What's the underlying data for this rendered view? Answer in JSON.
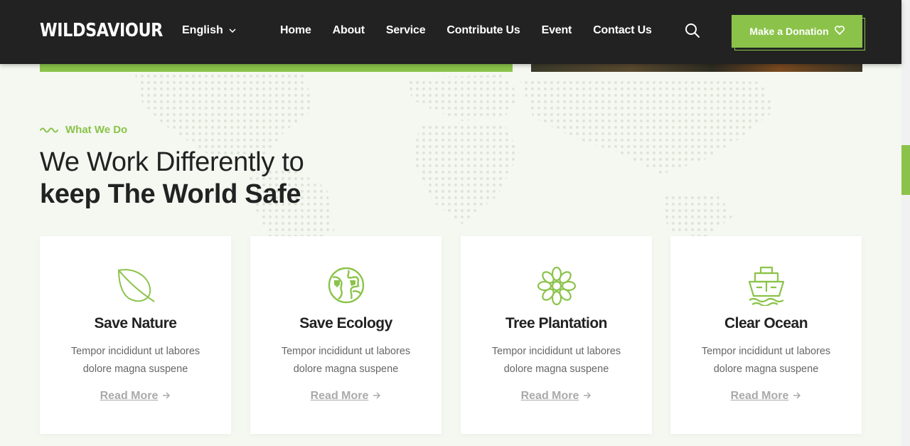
{
  "header": {
    "logo": "WILDSAVIOUR",
    "language": "English",
    "nav": [
      "Home",
      "About",
      "Service",
      "Contribute Us",
      "Event",
      "Contact Us"
    ],
    "donate_label": "Make a Donation"
  },
  "section": {
    "eyebrow": "What We Do",
    "heading_line1": "We Work Differently to",
    "heading_line2": "keep The World Safe"
  },
  "cards": [
    {
      "icon": "leaf-icon",
      "title": "Save Nature",
      "desc_line1": "Tempor incididunt ut labores",
      "desc_line2": "dolore magna suspene",
      "link": "Read More"
    },
    {
      "icon": "globe-icon",
      "title": "Save Ecology",
      "desc_line1": "Tempor incididunt ut labores",
      "desc_line2": "dolore magna suspene",
      "link": "Read More"
    },
    {
      "icon": "flower-icon",
      "title": "Tree Plantation",
      "desc_line1": "Tempor incididunt ut labores",
      "desc_line2": "dolore magna suspene",
      "link": "Read More"
    },
    {
      "icon": "ship-icon",
      "title": "Clear Ocean",
      "desc_line1": "Tempor incididunt ut labores",
      "desc_line2": "dolore magna suspene",
      "link": "Read More"
    }
  ],
  "colors": {
    "accent": "#8bc34a",
    "header_bg": "#222222",
    "page_bg": "#f4f8f0"
  }
}
